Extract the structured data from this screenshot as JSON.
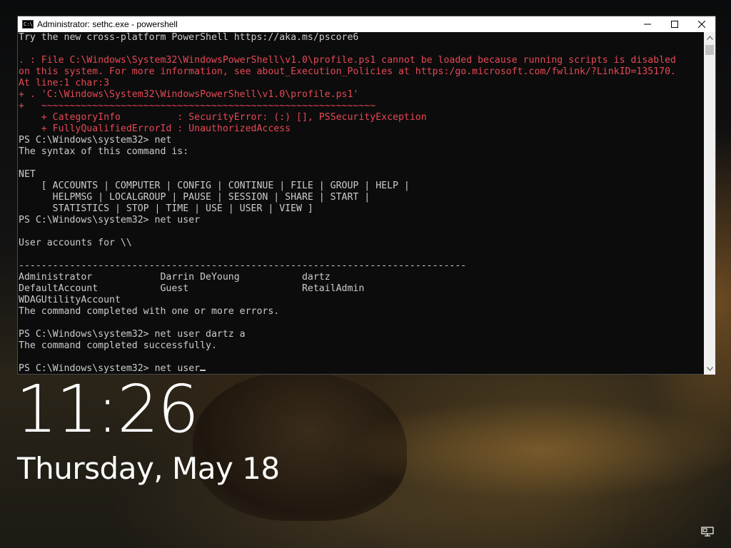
{
  "window": {
    "title": "Administrator: sethc.exe - powershell",
    "icon_text": "C:\\",
    "controls": [
      "minimize-icon",
      "maximize-icon",
      "close-icon"
    ]
  },
  "console": {
    "lines": [
      {
        "text": "Try the new cross-platform PowerShell https://aka.ms/pscore6",
        "style": "normal"
      },
      {
        "text": "",
        "style": "normal"
      },
      {
        "text": ". : File C:\\Windows\\System32\\WindowsPowerShell\\v1.0\\profile.ps1 cannot be loaded because running scripts is disabled",
        "style": "error"
      },
      {
        "text": "on this system. For more information, see about_Execution_Policies at https:/go.microsoft.com/fwlink/?LinkID=135170.",
        "style": "error"
      },
      {
        "text": "At line:1 char:3",
        "style": "error"
      },
      {
        "text": "+ . 'C:\\Windows\\System32\\WindowsPowerShell\\v1.0\\profile.ps1'",
        "style": "error"
      },
      {
        "text": "+   ~~~~~~~~~~~~~~~~~~~~~~~~~~~~~~~~~~~~~~~~~~~~~~~~~~~~~~~~~~~",
        "style": "error"
      },
      {
        "text": "    + CategoryInfo          : SecurityError: (:) [], PSSecurityException",
        "style": "error"
      },
      {
        "text": "    + FullyQualifiedErrorId : UnauthorizedAccess",
        "style": "error"
      },
      {
        "text": "PS C:\\Windows\\system32> net",
        "style": "normal"
      },
      {
        "text": "The syntax of this command is:",
        "style": "normal"
      },
      {
        "text": "",
        "style": "normal"
      },
      {
        "text": "NET",
        "style": "normal"
      },
      {
        "text": "    [ ACCOUNTS | COMPUTER | CONFIG | CONTINUE | FILE | GROUP | HELP |",
        "style": "normal"
      },
      {
        "text": "      HELPMSG | LOCALGROUP | PAUSE | SESSION | SHARE | START |",
        "style": "normal"
      },
      {
        "text": "      STATISTICS | STOP | TIME | USE | USER | VIEW ]",
        "style": "normal"
      },
      {
        "text": "PS C:\\Windows\\system32> net user",
        "style": "normal"
      },
      {
        "text": "",
        "style": "normal"
      },
      {
        "text": "User accounts for \\\\",
        "style": "normal"
      },
      {
        "text": "",
        "style": "normal"
      },
      {
        "text": "-------------------------------------------------------------------------------",
        "style": "normal"
      },
      {
        "text": "Administrator            Darrin DeYoung           dartz",
        "style": "normal"
      },
      {
        "text": "DefaultAccount           Guest                    RetailAdmin",
        "style": "normal"
      },
      {
        "text": "WDAGUtilityAccount",
        "style": "normal"
      },
      {
        "text": "The command completed with one or more errors.",
        "style": "normal"
      },
      {
        "text": "",
        "style": "normal"
      },
      {
        "text": "PS C:\\Windows\\system32> net user dartz a",
        "style": "normal"
      },
      {
        "text": "The command completed successfully.",
        "style": "normal"
      },
      {
        "text": "",
        "style": "normal"
      }
    ],
    "prompt": "PS C:\\Windows\\system32> ",
    "input_value": "net user",
    "colors": {
      "background": "#0c0c0c",
      "text": "#cccccc",
      "error": "#e74856"
    }
  },
  "lockscreen": {
    "time": "11:26",
    "date": "Thursday, May 18",
    "network_icon": "network-icon"
  }
}
